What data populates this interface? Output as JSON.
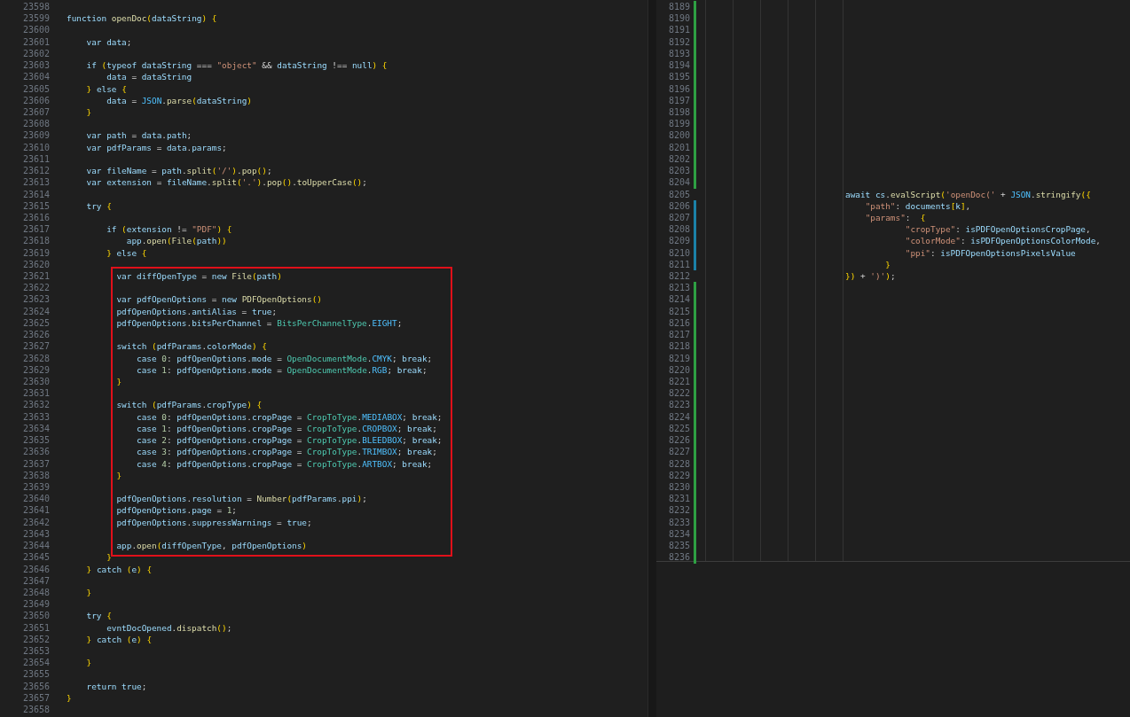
{
  "left_editor": {
    "lines_before_box": [
      {
        "line_number": "23598"
      },
      {
        "line_number": "23599",
        "text": "function openDoc(dataString) {"
      },
      {
        "line_number": "23600"
      },
      {
        "line_number": "23601",
        "text": "    var data;"
      },
      {
        "line_number": "23602"
      },
      {
        "line_number": "23603",
        "text": "    if (typeof dataString === \"object\" && dataString !== null) {"
      },
      {
        "line_number": "23604",
        "text": "        data = dataString"
      },
      {
        "line_number": "23605",
        "text": "    } else {"
      },
      {
        "line_number": "23606",
        "text": "        data = JSON.parse(dataString)"
      },
      {
        "line_number": "23607",
        "text": "    }"
      },
      {
        "line_number": "23608"
      },
      {
        "line_number": "23609",
        "text": "    var path = data.path;"
      },
      {
        "line_number": "23610",
        "text": "    var pdfParams = data.params;"
      },
      {
        "line_number": "23611"
      },
      {
        "line_number": "23612",
        "text": "    var fileName = path.split('/').pop();"
      },
      {
        "line_number": "23613",
        "text": "    var extension = fileName.split('.').pop().toUpperCase();"
      },
      {
        "line_number": "23614"
      },
      {
        "line_number": "23615",
        "text": "    try {"
      },
      {
        "line_number": "23616"
      },
      {
        "line_number": "23617",
        "text": "        if (extension != \"PDF\") {"
      },
      {
        "line_number": "23618",
        "text": "            app.open(File(path))"
      },
      {
        "line_number": "23619",
        "text": "        } else {"
      },
      {
        "line_number": "23620"
      }
    ],
    "boxed_lines": [
      {
        "line_number": "23621",
        "text": "          var diffOpenType = new File(path)"
      },
      {
        "line_number": "23622"
      },
      {
        "line_number": "23623",
        "text": "          var pdfOpenOptions = new PDFOpenOptions()"
      },
      {
        "line_number": "23624",
        "text": "          pdfOpenOptions.antiAlias = true;"
      },
      {
        "line_number": "23625",
        "text": "          pdfOpenOptions.bitsPerChannel = BitsPerChannelType.EIGHT;"
      },
      {
        "line_number": "23626"
      },
      {
        "line_number": "23627",
        "text": "          switch (pdfParams.colorMode) {"
      },
      {
        "line_number": "23628",
        "text": "              case 0: pdfOpenOptions.mode = OpenDocumentMode.CMYK; break;"
      },
      {
        "line_number": "23629",
        "text": "              case 1: pdfOpenOptions.mode = OpenDocumentMode.RGB; break;"
      },
      {
        "line_number": "23630",
        "text": "          }"
      },
      {
        "line_number": "23631"
      },
      {
        "line_number": "23632",
        "text": "          switch (pdfParams.cropType) {"
      },
      {
        "line_number": "23633",
        "text": "              case 0: pdfOpenOptions.cropPage = CropToType.MEDIABOX; break;"
      },
      {
        "line_number": "23634",
        "text": "              case 1: pdfOpenOptions.cropPage = CropToType.CROPBOX; break;"
      },
      {
        "line_number": "23635",
        "text": "              case 2: pdfOpenOptions.cropPage = CropToType.BLEEDBOX; break;"
      },
      {
        "line_number": "23636",
        "text": "              case 3: pdfOpenOptions.cropPage = CropToType.TRIMBOX; break;"
      },
      {
        "line_number": "23637",
        "text": "              case 4: pdfOpenOptions.cropPage = CropToType.ARTBOX; break;"
      },
      {
        "line_number": "23638",
        "text": "          }"
      },
      {
        "line_number": "23639"
      },
      {
        "line_number": "23640",
        "text": "          pdfOpenOptions.resolution = Number(pdfParams.ppi);"
      },
      {
        "line_number": "23641",
        "text": "          pdfOpenOptions.page = 1;"
      },
      {
        "line_number": "23642",
        "text": "          pdfOpenOptions.suppressWarnings = true;"
      },
      {
        "line_number": "23643"
      },
      {
        "line_number": "23644",
        "text": "          app.open(diffOpenType, pdfOpenOptions)"
      }
    ],
    "lines_after_box": [
      {
        "line_number": "23645",
        "text": "        }"
      },
      {
        "line_number": "23646",
        "text": "    } catch (e) {"
      },
      {
        "line_number": "23647"
      },
      {
        "line_number": "23648",
        "text": "    }"
      },
      {
        "line_number": "23649"
      },
      {
        "line_number": "23650",
        "text": "    try {"
      },
      {
        "line_number": "23651",
        "text": "        evntDocOpened.dispatch();"
      },
      {
        "line_number": "23652",
        "text": "    } catch (e) {"
      },
      {
        "line_number": "23653"
      },
      {
        "line_number": "23654",
        "text": "    }"
      },
      {
        "line_number": "23655"
      },
      {
        "line_number": "23656",
        "text": "    return true;"
      },
      {
        "line_number": "23657",
        "text": "}"
      },
      {
        "line_number": "23658"
      }
    ]
  },
  "right_editor": {
    "lines": [
      {
        "line_number": "8189",
        "added": true,
        "modified": false
      },
      {
        "line_number": "8190",
        "added": true,
        "modified": false
      },
      {
        "line_number": "8191",
        "added": true,
        "modified": false
      },
      {
        "line_number": "8192",
        "added": true,
        "modified": false
      },
      {
        "line_number": "8193",
        "added": true,
        "modified": false
      },
      {
        "line_number": "8194",
        "added": true,
        "modified": false
      },
      {
        "line_number": "8195",
        "added": true,
        "modified": false
      },
      {
        "line_number": "8196",
        "added": true,
        "modified": false
      },
      {
        "line_number": "8197",
        "added": true,
        "modified": false
      },
      {
        "line_number": "8198",
        "added": true,
        "modified": false
      },
      {
        "line_number": "8199",
        "added": true,
        "modified": false
      },
      {
        "line_number": "8200",
        "added": true,
        "modified": false
      },
      {
        "line_number": "8201",
        "added": true,
        "modified": false
      },
      {
        "line_number": "8202",
        "added": true,
        "modified": false
      },
      {
        "line_number": "8203",
        "added": true,
        "modified": false
      },
      {
        "line_number": "8204",
        "added": true,
        "modified": false
      },
      {
        "line_number": "8205",
        "text": "                            await cs.evalScript('openDoc(' + JSON.stringify({",
        "added": false,
        "modified": false
      },
      {
        "line_number": "8206",
        "text": "                                \"path\": documents[k],",
        "added": false,
        "modified": true
      },
      {
        "line_number": "8207",
        "text": "                                \"params\":  {",
        "added": false,
        "modified": true
      },
      {
        "line_number": "8208",
        "text": "                                        \"cropType\": isPDFOpenOptionsCropPage,",
        "added": false,
        "modified": true
      },
      {
        "line_number": "8209",
        "text": "                                        \"colorMode\": isPDFOpenOptionsColorMode,",
        "added": false,
        "modified": true
      },
      {
        "line_number": "8210",
        "text": "                                        \"ppi\": isPDFOpenOptionsPixelsValue",
        "added": false,
        "modified": true
      },
      {
        "line_number": "8211",
        "text": "                                    }",
        "added": false,
        "modified": true
      },
      {
        "line_number": "8212",
        "text": "                            }) + ')');",
        "added": false,
        "modified": false
      },
      {
        "line_number": "8213",
        "added": true,
        "modified": false
      },
      {
        "line_number": "8214",
        "added": true,
        "modified": false
      },
      {
        "line_number": "8215",
        "added": true,
        "modified": false
      },
      {
        "line_number": "8216",
        "added": true,
        "modified": false
      },
      {
        "line_number": "8217",
        "added": true,
        "modified": false
      },
      {
        "line_number": "8218",
        "added": true,
        "modified": false
      },
      {
        "line_number": "8219",
        "added": true,
        "modified": false
      },
      {
        "line_number": "8220",
        "added": true,
        "modified": false
      },
      {
        "line_number": "8221",
        "added": true,
        "modified": false
      },
      {
        "line_number": "8222",
        "added": true,
        "modified": false
      },
      {
        "line_number": "8223",
        "added": true,
        "modified": false
      },
      {
        "line_number": "8224",
        "added": true,
        "modified": false
      },
      {
        "line_number": "8225",
        "added": true,
        "modified": false
      },
      {
        "line_number": "8226",
        "added": true,
        "modified": false
      },
      {
        "line_number": "8227",
        "added": true,
        "modified": false
      },
      {
        "line_number": "8228",
        "added": true,
        "modified": false
      },
      {
        "line_number": "8229",
        "added": true,
        "modified": false
      },
      {
        "line_number": "8230",
        "added": true,
        "modified": false
      },
      {
        "line_number": "8231",
        "added": true,
        "modified": false
      },
      {
        "line_number": "8232",
        "added": true,
        "modified": false
      },
      {
        "line_number": "8233",
        "added": true,
        "modified": false
      },
      {
        "line_number": "8234",
        "added": true,
        "modified": false
      },
      {
        "line_number": "8235",
        "added": true,
        "modified": false
      },
      {
        "line_number": "8236",
        "added": true,
        "modified": false
      }
    ]
  }
}
